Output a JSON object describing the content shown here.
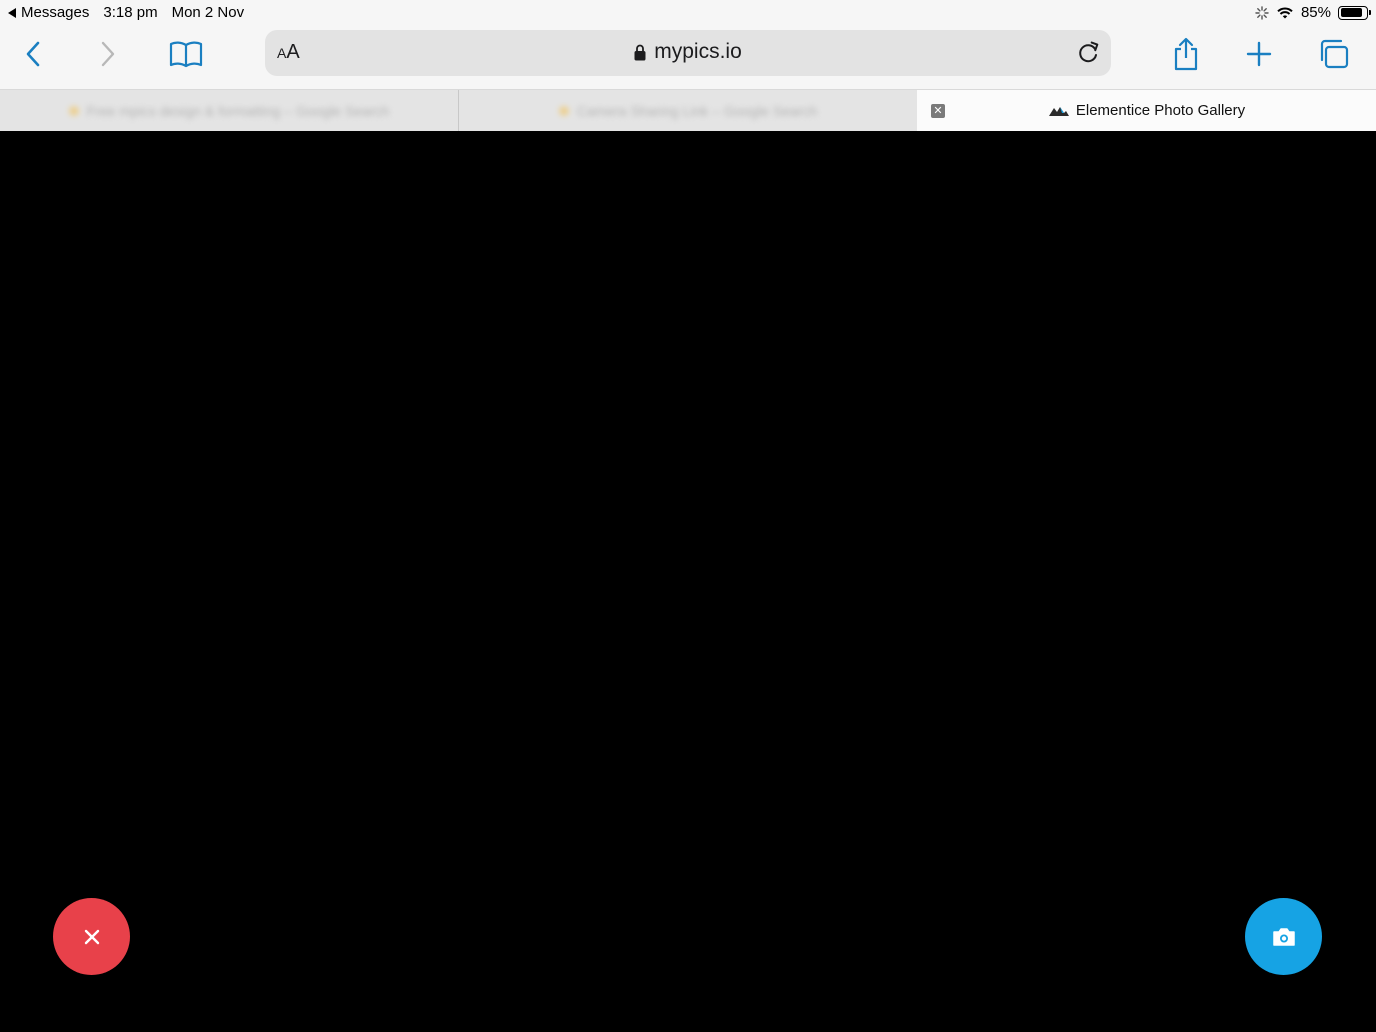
{
  "status_bar": {
    "back_app": "Messages",
    "time": "3:18 pm",
    "date": "Mon 2 Nov",
    "battery_percent": "85%",
    "battery_level": 0.85
  },
  "toolbar": {
    "text_size_label_small": "A",
    "text_size_label_large": "A",
    "url": "mypics.io",
    "accent_color": "#1a7fc1"
  },
  "tabs": {
    "inactive_1": "Free mpics design & formatting – Google Search",
    "inactive_2": "Camera Sharing Link – Google Search",
    "active_title": "Elementice Photo Gallery",
    "close_glyph": "✕"
  },
  "content": {
    "close_button_color": "#e8414a",
    "camera_button_color": "#16a3e4"
  }
}
